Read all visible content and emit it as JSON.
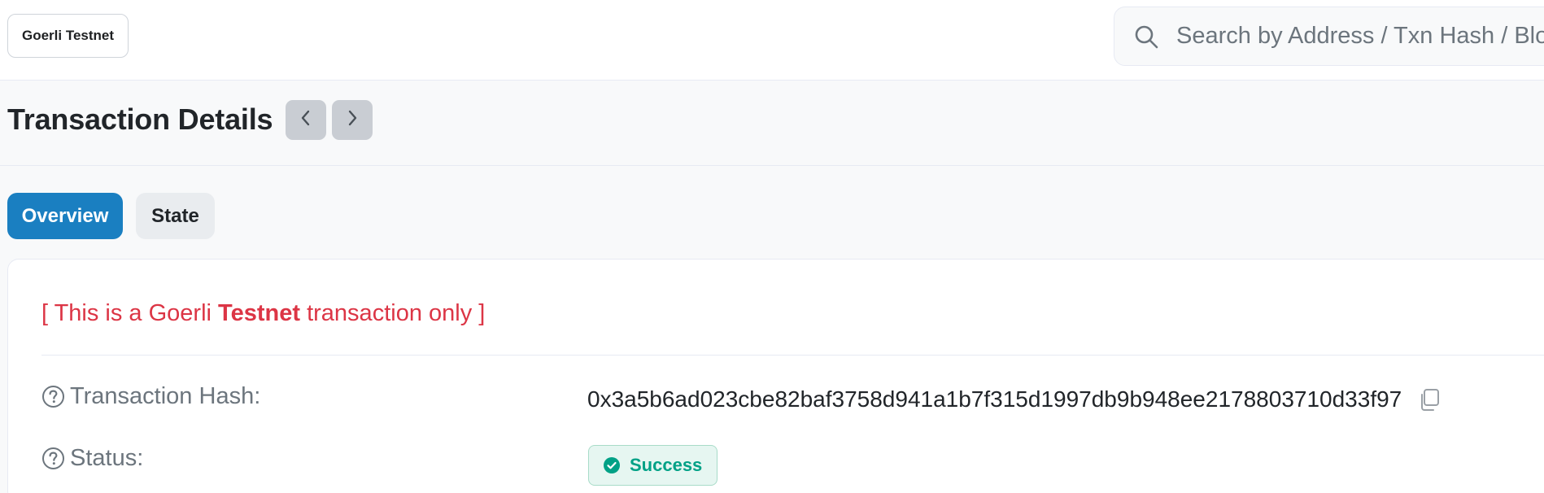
{
  "header": {
    "network_label": "Goerli Testnet",
    "search_placeholder": "Search by Address / Txn Hash / Block / Token"
  },
  "page": {
    "title": "Transaction Details"
  },
  "tabs": [
    {
      "label": "Overview",
      "active": true
    },
    {
      "label": "State",
      "active": false
    }
  ],
  "notice": {
    "prefix": "[ This is a Goerli ",
    "emphasis": "Testnet",
    "suffix": " transaction only ]"
  },
  "details": {
    "hash_label": "Transaction Hash:",
    "hash_value": "0x3a5b6ad023cbe82baf3758d941a1b7f315d1997db9b948ee2178803710d33f97",
    "status_label": "Status:",
    "status_value": "Success"
  },
  "icons": {
    "search": "search-icon",
    "prev": "chevron-left-icon",
    "next": "chevron-right-icon",
    "help": "question-circle-icon",
    "copy": "copy-icon",
    "check": "check-circle-icon"
  },
  "colors": {
    "accent": "#1a7fc1",
    "danger": "#dc3545",
    "success": "#00a186"
  }
}
